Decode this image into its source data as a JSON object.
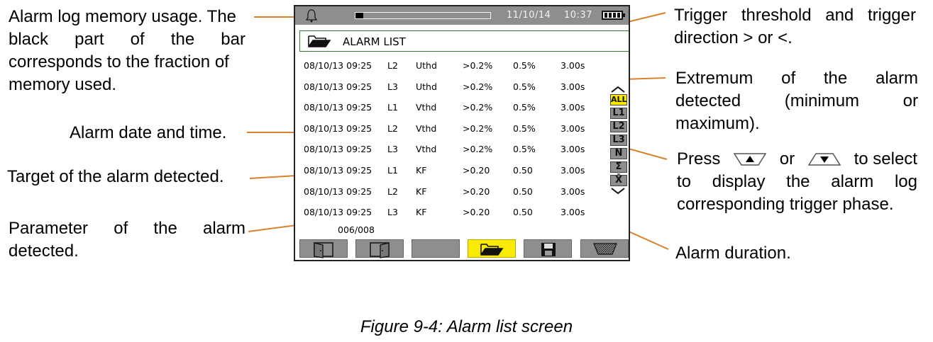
{
  "annotations": {
    "memory_usage": [
      "Alarm log memory usage. The",
      "black part of the bar",
      "corresponds to the fraction of",
      "memory used."
    ],
    "date_time": "Alarm date and time.",
    "target": "Target of the alarm detected.",
    "parameter": [
      "Parameter of the alarm",
      "detected."
    ],
    "trigger": [
      "Trigger threshold and trigger",
      "direction > or <."
    ],
    "extremum": [
      "Extremum of the alarm",
      "detected (minimum or",
      "maximum)."
    ],
    "press": {
      "word_press": "Press",
      "up_key_icon": "up-arrow-key-icon",
      "word_or": "or",
      "down_key_icon": "down-arrow-key-icon",
      "word_to_select": "to select",
      "line2": "to display the alarm log",
      "line3": "corresponding trigger phase."
    },
    "duration": "Alarm duration."
  },
  "caption": "Figure 9-4: Alarm list screen",
  "screen": {
    "status_bar": {
      "bell_icon": "bell-icon",
      "memory_used_fraction": 0.06,
      "date": "11/10/14",
      "time": "10:37",
      "battery_icon": "battery-full-icon"
    },
    "title": "ALARM LIST",
    "title_icon": "open-folder-icon",
    "rows": [
      {
        "datetime": "08/10/13 09:25",
        "target": "L2",
        "parameter": "Uthd",
        "threshold": ">0.2%",
        "extremum": "0.5%",
        "duration": "3.00s"
      },
      {
        "datetime": "08/10/13 09:25",
        "target": "L3",
        "parameter": "Uthd",
        "threshold": ">0.2%",
        "extremum": "0.5%",
        "duration": "3.00s"
      },
      {
        "datetime": "08/10/13 09:25",
        "target": "L1",
        "parameter": "Vthd",
        "threshold": ">0.2%",
        "extremum": "0.5%",
        "duration": "3.00s"
      },
      {
        "datetime": "08/10/13 09:25",
        "target": "L2",
        "parameter": "Vthd",
        "threshold": ">0.2%",
        "extremum": "0.5%",
        "duration": "3.00s"
      },
      {
        "datetime": "08/10/13 09:25",
        "target": "L3",
        "parameter": "Vthd",
        "threshold": ">0.2%",
        "extremum": "0.5%",
        "duration": "3.00s"
      },
      {
        "datetime": "08/10/13 09:25",
        "target": "L1",
        "parameter": "KF",
        "threshold": ">0.20",
        "extremum": "0.50",
        "duration": "3.00s"
      },
      {
        "datetime": "08/10/13 09:25",
        "target": "L2",
        "parameter": "KF",
        "threshold": ">0.20",
        "extremum": "0.50",
        "duration": "3.00s"
      },
      {
        "datetime": "08/10/13 09:25",
        "target": "L3",
        "parameter": "KF",
        "threshold": ">0.20",
        "extremum": "0.50",
        "duration": "3.00s"
      }
    ],
    "page_counter": "006/008",
    "phase_selector": {
      "items": [
        "ALL",
        "L1",
        "L2",
        "L3",
        "N",
        "Σ",
        "X̄"
      ],
      "active": "ALL",
      "up_icon": "chevron-up-icon",
      "down_icon": "chevron-down-icon"
    },
    "softkeys": [
      {
        "icon": "exit-door-icon",
        "active": false
      },
      {
        "icon": "enter-door-icon",
        "active": false
      },
      {
        "icon": "blank-key",
        "active": false
      },
      {
        "icon": "open-folder-icon",
        "active": true
      },
      {
        "icon": "floppy-disk-icon",
        "active": false
      },
      {
        "icon": "trash-bin-icon",
        "active": false
      }
    ],
    "colors": {
      "leader_line": "#d9822b",
      "status_bar": "#8e8e8e",
      "highlight_yellow": "#f5e700",
      "title_border": "#2e7d32"
    }
  }
}
